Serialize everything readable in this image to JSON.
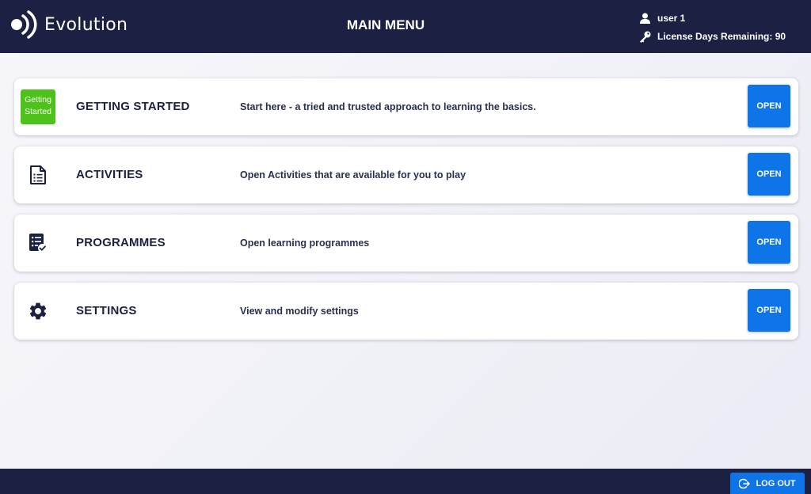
{
  "app": {
    "name": "Evolution"
  },
  "header": {
    "title": "MAIN MENU",
    "user": "user 1",
    "license": "License Days Remaining: 90"
  },
  "menu": {
    "items": [
      {
        "icon": "getting-started-badge-icon",
        "badge_line1": "Getting",
        "badge_line2": "Started",
        "title": "GETTING STARTED",
        "description": "Start here - a tried and trusted approach to learning the basics.",
        "button": "OPEN"
      },
      {
        "icon": "document-list-icon",
        "title": "ACTIVITIES",
        "description": "Open Activities that are available for you to play",
        "button": "OPEN"
      },
      {
        "icon": "checklist-icon",
        "title": "PROGRAMMES",
        "description": "Open learning programmes",
        "button": "OPEN"
      },
      {
        "icon": "gear-icon",
        "title": "SETTINGS",
        "description": "View and modify settings",
        "button": "OPEN"
      }
    ]
  },
  "footer": {
    "logout_label": "LOG OUT"
  },
  "colors": {
    "header_bg": "#1c2143",
    "accent": "#0d75e8",
    "badge_green": "#4cc21a",
    "page_bg": "#f3f3f8"
  }
}
